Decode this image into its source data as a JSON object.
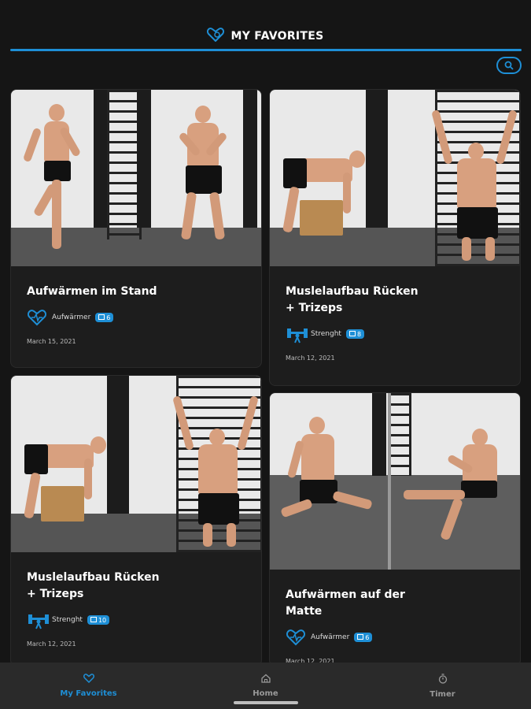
{
  "header": {
    "title": "MY FAVORITES",
    "icon": "heart-logo-icon"
  },
  "search": {
    "icon": "search-icon"
  },
  "cards": [
    {
      "title": "Aufwärmen im Stand",
      "category": "Aufwärmer",
      "category_icon": "heart-icon",
      "count": "6",
      "date": "March 15, 2021"
    },
    {
      "title": "Muslelaufbau Rücken\n+ Trizeps",
      "category": "Strenght",
      "category_icon": "dumbbell-icon",
      "count": "8",
      "date": "March 12, 2021"
    },
    {
      "title": "Muslelaufbau Rücken\n+ Trizeps",
      "category": "Strenght",
      "category_icon": "dumbbell-icon",
      "count": "10",
      "date": "March 12, 2021"
    },
    {
      "title": "Aufwärmen auf der\nMatte",
      "category": "Aufwärmer",
      "category_icon": "heart-icon",
      "count": "6",
      "date": "March 12, 2021"
    }
  ],
  "nav": {
    "items": [
      {
        "label": "My Favorites",
        "icon": "heart-icon"
      },
      {
        "label": "Home",
        "icon": "home-icon"
      },
      {
        "label": "Timer",
        "icon": "timer-icon"
      }
    ]
  },
  "colors": {
    "accent": "#1e8fd6",
    "background": "#151515",
    "card": "#1d1d1d",
    "nav": "#2a2a2a"
  }
}
